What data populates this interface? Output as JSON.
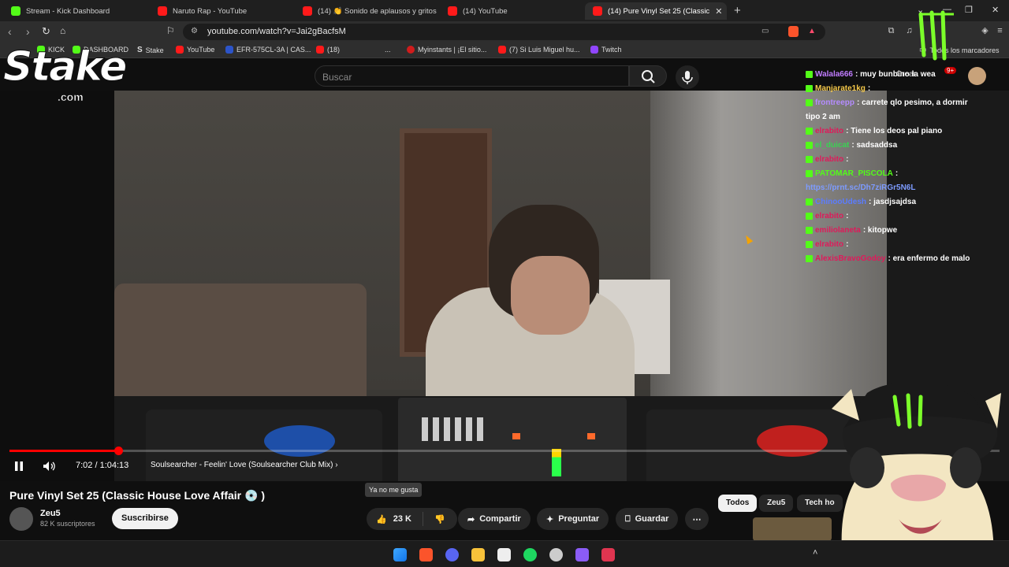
{
  "browser": {
    "tabs": [
      {
        "title": "Stream - Kick Dashboard",
        "icon": "kick-icon"
      },
      {
        "title": "Naruto Rap - YouTube",
        "icon": "youtube-icon"
      },
      {
        "title": "(14) 👏 Sonido de aplausos y gritos",
        "icon": "youtube-icon"
      },
      {
        "title": "(14) YouTube",
        "icon": "youtube-icon"
      },
      {
        "title": "(14) Pure Vinyl Set 25 (Classic",
        "icon": "youtube-icon",
        "active": true
      }
    ],
    "new_tab": "+",
    "url": "youtube.com/watch?v=Jai2gBacfsM",
    "bookmarks": [
      {
        "label": "KICK",
        "icon": "kick-icon"
      },
      {
        "label": "DASHBOARD",
        "icon": "kick-icon"
      },
      {
        "label": "Stake",
        "icon": "stake-icon"
      },
      {
        "label": "YouTube",
        "icon": "youtube-icon"
      },
      {
        "label": "EFR-575CL-3A | CAS...",
        "icon": "casio-icon"
      },
      {
        "label": "(18)",
        "icon": "youtube-icon"
      },
      {
        "label": "...",
        "icon": ""
      },
      {
        "label": "Myinstants | ¡El sitio...",
        "icon": "myinstants-icon"
      },
      {
        "label": "(7) Si Luis Miguel hu...",
        "icon": "youtube-icon"
      },
      {
        "label": "Twitch",
        "icon": "twitch-icon"
      }
    ],
    "all_bookmarks": "Todos los marcadores"
  },
  "youtube": {
    "search_placeholder": "Buscar",
    "create_label": "Crear",
    "notifications": "9+",
    "player": {
      "time_current": "7:02",
      "time_sep": " / ",
      "time_total": "1:04:13",
      "chapter": "Soulsearcher - Feelin' Love (Soulsearcher Club Mix)",
      "progress_fraction": 0.11
    },
    "video_title": "Pure Vinyl Set 25 (Classic House Love Affair 💿 )",
    "tooltip": "Ya no me gusta",
    "channel": {
      "name": "Zeu5",
      "subscribers": "82 K suscriptores"
    },
    "subscribe": "Suscribirse",
    "likes": "23 K",
    "share": "Compartir",
    "ask": "Preguntar",
    "save": "Guardar",
    "chips": [
      "Todos",
      "Zeu5",
      "Tech ho"
    ]
  },
  "chat": [
    {
      "user": "Walala666",
      "color": "#c07cff",
      "msg": ": muy bunbino la wea"
    },
    {
      "user": "Manjarate1kg",
      "color": "#f6c94a",
      "msg": ":"
    },
    {
      "user": "frontreepp",
      "color": "#b48cff",
      "msg": ": carrete qlo pesimo, a dormir"
    },
    {
      "user": "",
      "color": "#fff",
      "msg": "tipo 2 am"
    },
    {
      "user": "elrabito",
      "color": "#e0195a",
      "msg": ": Tiene los deos pal piano"
    },
    {
      "user": "el_duicat",
      "color": "#39d353",
      "msg": ": sadsaddsa"
    },
    {
      "user": "elrabito",
      "color": "#e0195a",
      "msg": ":"
    },
    {
      "user": "PATOMAR_PISCOLA",
      "color": "#53fc18",
      "msg": ":"
    },
    {
      "user": "",
      "color": "#7d9bff",
      "msg": "https://prnt.sc/Dh7ziRGr5N6L"
    },
    {
      "user": "ChinooUdesh",
      "color": "#5b7cff",
      "msg": ": jasdjsajdsa"
    },
    {
      "user": "elrabito",
      "color": "#e0195a",
      "msg": ":"
    },
    {
      "user": "emiliolaneta",
      "color": "#e0195a",
      "msg": ": kitopwe"
    },
    {
      "user": "elrabito",
      "color": "#e0195a",
      "msg": ":"
    },
    {
      "user": "AlexisBravoGodoy",
      "color": "#e0195a",
      "msg": ": era enfermo de malo"
    }
  ],
  "overlay": {
    "stake_word": "Stake",
    "stake_com": ".com"
  },
  "colors": {
    "accent": "#ff0000",
    "kick": "#53fc18",
    "bg": "#0f0f0f"
  }
}
